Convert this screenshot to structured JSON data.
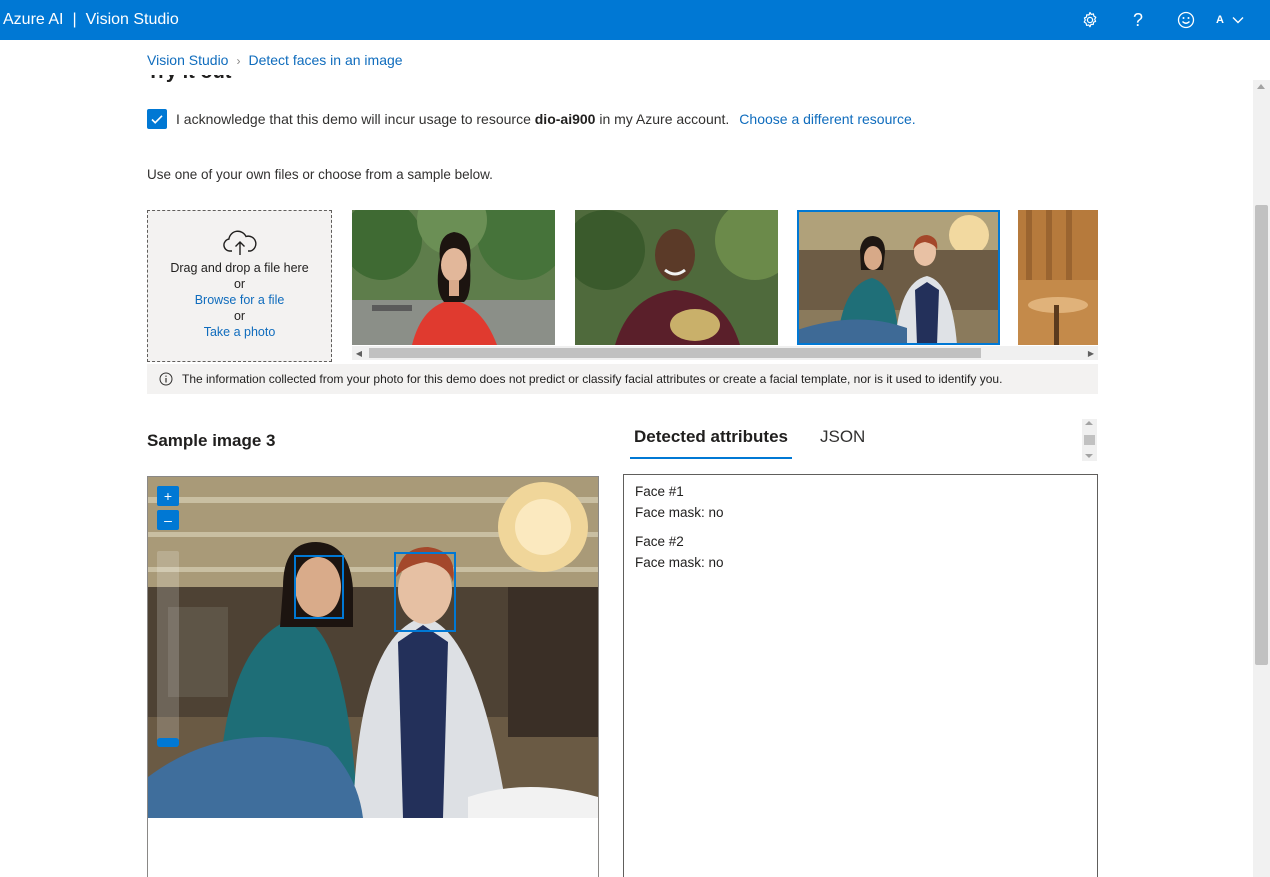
{
  "header": {
    "brand": "Azure AI",
    "separator": "|",
    "product": "Vision Studio",
    "icons": [
      "gear-icon",
      "help-icon",
      "smiley-feedback-icon",
      "chevron-down-icon"
    ],
    "account_initial": "A"
  },
  "breadcrumb": {
    "items": [
      "Vision Studio",
      "Detect faces in an image"
    ]
  },
  "section_title": "Try it out",
  "acknowledge": {
    "checked": true,
    "text_before": "I acknowledge that this demo will incur usage to resource",
    "resource": "dio-ai900",
    "text_after": "in my Azure account.",
    "link": "Choose a different resource."
  },
  "instructions": "Use one of your own files or choose from a sample below.",
  "dropzone": {
    "line1": "Drag and drop a file here",
    "or1": "or",
    "browse_link": "Browse for a file",
    "or2": "or",
    "photo_link": "Take a photo"
  },
  "samples": {
    "count_visible": 4,
    "selected_index": 3
  },
  "info_notice": "The information collected from your photo for this demo does not predict or classify facial attributes or create a facial template, nor is it used to identify you.",
  "preview": {
    "title": "Sample image 3",
    "faces_detected": 2
  },
  "tabs": [
    {
      "label": "Detected attributes",
      "active": true
    },
    {
      "label": "JSON",
      "active": false
    }
  ],
  "results": [
    {
      "face": "Face #1",
      "mask": "Face mask: no"
    },
    {
      "face": "Face #2",
      "mask": "Face mask: no"
    }
  ],
  "colors": {
    "accent": "#0078d4",
    "link": "#0f6cbd",
    "panel_bg": "#f3f2f1"
  }
}
